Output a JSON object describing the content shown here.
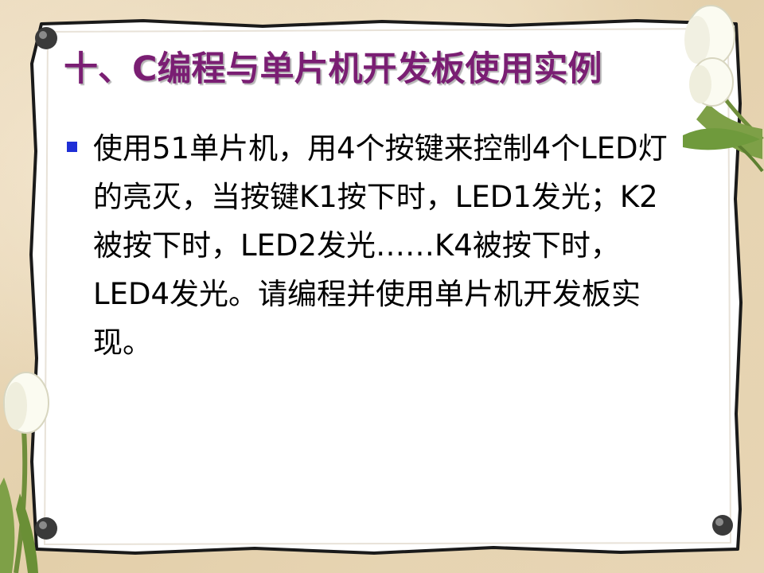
{
  "slide": {
    "title": "十、C编程与单片机开发板使用实例",
    "bullet_text": "使用51单片机，用4个按键来控制4个LED灯的亮灭，当按键K1按下时，LED1发光；K2被按下时，LED2发光……K4被按下时，LED4发光。请编程并使用单片机开发板实现。"
  },
  "colors": {
    "title": "#7a1e73",
    "bullet": "#1f2fd6",
    "paper": "#ffffff",
    "background": "#e6d3b1"
  },
  "icons": [
    "tulip-flower-icon",
    "pushpin-icon"
  ]
}
